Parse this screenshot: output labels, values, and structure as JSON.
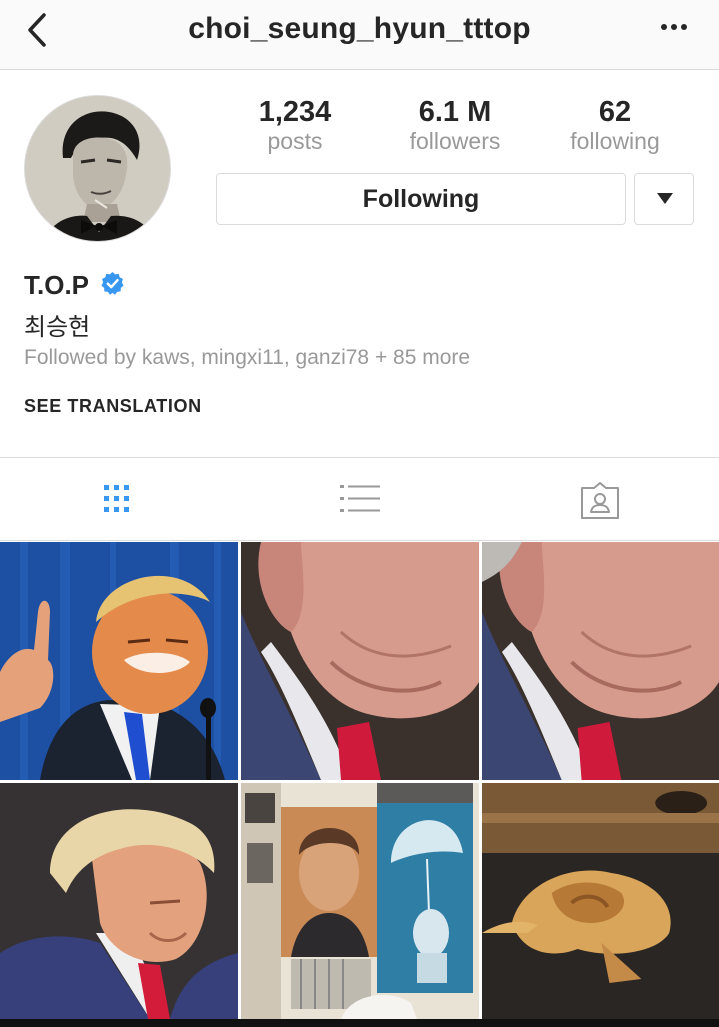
{
  "header": {
    "username": "choi_seung_hyun_tttop",
    "back_icon": "chevron-left-icon",
    "more_icon": "ellipsis-icon"
  },
  "profile": {
    "avatar_icon": "profile-photo",
    "stats": [
      {
        "value": "1,234",
        "label": "posts"
      },
      {
        "value": "6.1 M",
        "label": "followers"
      },
      {
        "value": "62",
        "label": "following"
      }
    ],
    "follow_button_label": "Following",
    "dropdown_icon": "triangle-down-icon",
    "display_name": "T.O.P",
    "verified_icon": "verified-badge-icon",
    "korean_name": "최승현",
    "followed_by": "Followed by kaws, mingxi11, ganzi78 + 85 more",
    "see_translation": "SEE TRANSLATION"
  },
  "tabs": [
    {
      "icon": "grid-icon",
      "active": true
    },
    {
      "icon": "list-icon",
      "active": false
    },
    {
      "icon": "tagged-person-icon",
      "active": false
    }
  ],
  "colors": {
    "accent": "#3897f0",
    "text": "#262626",
    "muted": "#999999",
    "border": "#dbdbdb"
  },
  "posts": [
    {
      "name": "post-thumbnail-1"
    },
    {
      "name": "post-thumbnail-2"
    },
    {
      "name": "post-thumbnail-3"
    },
    {
      "name": "post-thumbnail-4"
    },
    {
      "name": "post-thumbnail-5"
    },
    {
      "name": "post-thumbnail-6"
    }
  ]
}
